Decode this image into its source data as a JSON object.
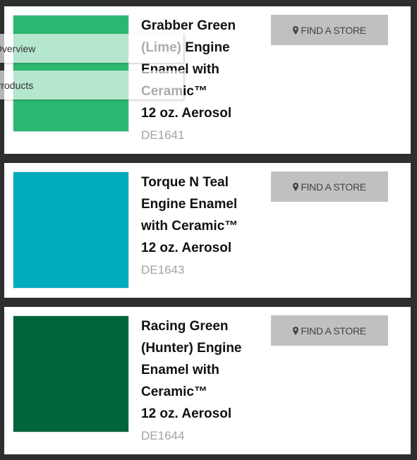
{
  "overlay_menu": {
    "items": [
      {
        "label": "Overview"
      },
      {
        "label": "Products"
      }
    ]
  },
  "products": [
    {
      "title_lines": [
        "Grabber Green",
        "(Lime) Engine",
        "Enamel with",
        "Ceramic™",
        "12 oz. Aerosol"
      ],
      "sku": "DE1641",
      "swatch_color": "#2db872",
      "find_store_label": "FIND A STORE",
      "find_store_icon": "map-pin-icon"
    },
    {
      "title_lines": [
        "Torque N Teal",
        "Engine Enamel",
        "with Ceramic™",
        "12 oz. Aerosol"
      ],
      "sku": "DE1643",
      "swatch_color": "#00abc0",
      "find_store_label": "FIND A STORE",
      "find_store_icon": "map-pin-icon"
    },
    {
      "title_lines": [
        "Racing Green",
        "(Hunter) Engine",
        "Enamel with",
        "Ceramic™",
        "12 oz. Aerosol"
      ],
      "sku": "DE1644",
      "swatch_color": "#00663a",
      "find_store_label": "FIND A STORE",
      "find_store_icon": "map-pin-icon"
    }
  ]
}
